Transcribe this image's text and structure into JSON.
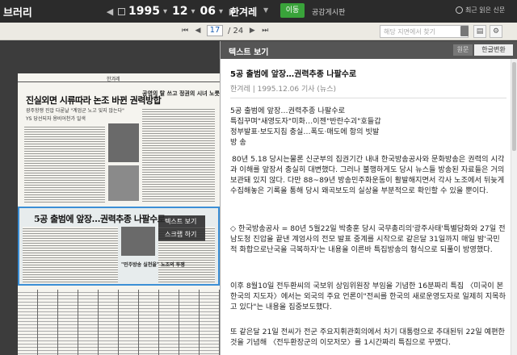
{
  "topbar": {
    "brand": "브러리",
    "year": "1995",
    "month": "12",
    "day": "06",
    "paper": "한겨레",
    "go_label": "이동",
    "board_label": "공감게시판",
    "recent_label": "최근 읽은 신문"
  },
  "toolbar": {
    "current_page": "17",
    "total_pages": "/ 24",
    "search_placeholder": "해당 지면에서 찾기"
  },
  "newspaper": {
    "masthead": "한겨레",
    "headline1": "진실외면 시류따라 논조 바뀐 권력방합",
    "subhead1a": "광주항쟁 진압 다룬날 \"계엄군 노고 잊지 않는다\"",
    "subhead1b": "YS 당선되자 용비어천가 일색",
    "headline2": "5공 출범에 앞장…권력추종 나팔수로",
    "side_head": "공영의 탈 쓰고 정권의 시녀 노릇",
    "bottom_title": "\"민주방송 실천을\" 노조의 투쟁"
  },
  "context_menu": {
    "items": [
      "텍스트 보기",
      "스크랩 하기"
    ]
  },
  "panel": {
    "title": "텍스트 보기",
    "tab_original": "원문",
    "tab_convert": "한글변환",
    "article_title": "5공 출범에 앞장…권력추종 나팔수로",
    "article_meta": "한겨레 | 1995.12.06 기사 (뉴스)",
    "paragraphs": [
      "5공 출범에 앞장…권력추종 나팔수로\n특집꾸며\"새영도자\"미화…이젠\"반란수괴\"호들갑\n정부발표·보도지침 충실…폭도·매도에 항의 빗발\n방 송",
      "80년 5.18 당시는물론 신군부의 집권기간 내내 한국방송공사와 문화방송은 권력의 시각과 이해를 앞장서 충실히 대변했다. 그러나 불행하게도 당시 뉴스들 방송된 자료들은 거의 보관돼 있지 않다. 다만 88~89년 방송민주화운동이 활발해지면서 각사 노조에서 뒤늦게 수집해놓은 기록을 통해 당시 왜곡보도의 실상을 부분적으로 확인할 수 있을 뿐이다.",
      "◇ 한국방송공사 = 80년 5월22일 박충훈 당시 국무총리의'광주사태'특별담화와 27일 전남도청 진압을 끝낸 계엄사의 전모 발표 중계를 시작으로 같은달 31일까지 매일 밤'국민적 화합으로난국을 극복하자'는 내용을 이른바 특집방송의 형식으로 되풀이 방영했다.",
      "이후 8월10일 전두환씨의 국보위 상임위원장 부임을 기념한 16분짜리 특집 〈미국이 본 한국의 지도자〉에서는 외국의 주요 언론이\"전씨를 한국의 새로운영도자로 일제히 지목하고 있다\"는 내용을 집중보도했다.",
      "또 같은달 21일 전씨가 전군 주요지휘관회의에서 차기 대통령으로 추대된뒤 22일 예편한 것을 기념해 〈전두환장군의 이모저모〉를 1시간짜리 특집으로 꾸몄다."
    ]
  }
}
